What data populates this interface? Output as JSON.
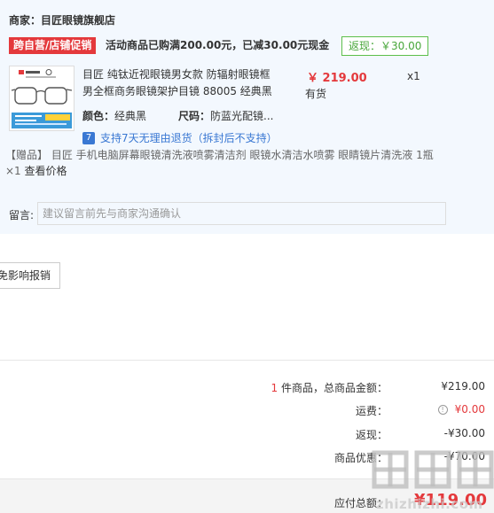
{
  "merchant": {
    "label": "商家：目匠眼镜旗舰店"
  },
  "promo": {
    "tag": "跨自营/店铺促销",
    "text": "活动商品已购满200.00元，已减30.00元现金",
    "rebate": "返现：￥30.00"
  },
  "product": {
    "image_caption": "目匠眼镜 纯钛近视眼镜",
    "title": "目匠 纯钛近视眼镜男女款 防辐射眼镜框男全框商务眼镜架护目镜 88005 经典黑",
    "price": "￥ 219.00",
    "stock": "有货",
    "quantity": "x1",
    "color_label": "颜色：",
    "color_value": "经典黑",
    "size_label": "尺码：",
    "size_value": "防蓝光配镜..."
  },
  "return_policy": {
    "icon": "return-7day-icon",
    "text": "支持7天无理由退货（拆封后不支持）"
  },
  "gift": {
    "text": "【赠品】 目匠 手机电脑屏幕眼镜清洗液喷雾清洁剂 眼镜水清洁水喷雾 眼睛镜片清洗液 1瓶 ×1",
    "view_price": "查看价格"
  },
  "memo": {
    "label": "留言:",
    "placeholder": "建议留言前先与商家沟通确认"
  },
  "reimburse_button": "免影响报销",
  "summary": {
    "count": "1",
    "count_text": " 件商品，总商品金额：",
    "total_value": "¥219.00",
    "shipping_label": "运费：",
    "shipping_value": "¥0.00",
    "rebate_label": "返现：",
    "rebate_value": "-¥30.00",
    "discount_label": "商品优惠：",
    "discount_value": "-¥70.00"
  },
  "pay": {
    "label": "应付总额：",
    "amount": "¥119.00"
  },
  "watermark": "zhizhizhi.com",
  "colors": {
    "accent_red": "#e4393c",
    "rebate_green": "#47a63a",
    "card_bg": "#f3f8fe",
    "link_blue": "#3a78d3"
  }
}
